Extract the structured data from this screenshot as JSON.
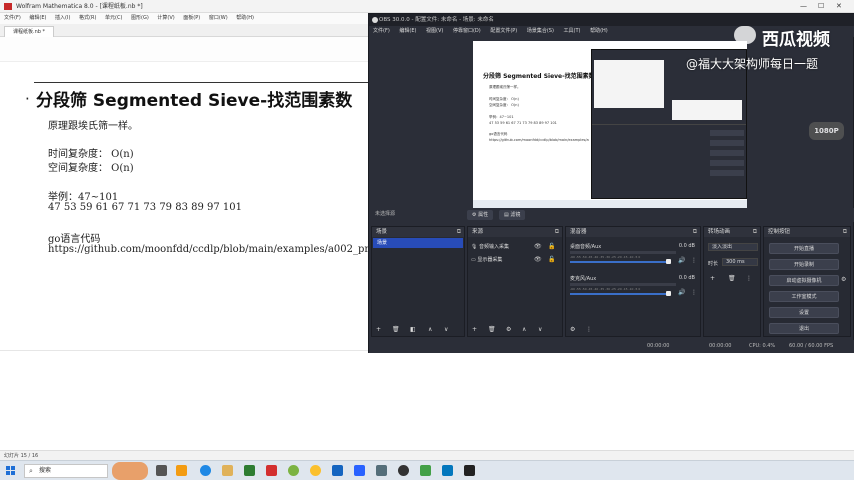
{
  "mathematica": {
    "window_title": "Wolfram Mathematica 8.0 - [课程纸板.nb *]",
    "menu": [
      "文件(F)",
      "编辑(E)",
      "插入(I)",
      "格式(R)",
      "单元(C)",
      "图形(G)",
      "计算(V)",
      "面板(P)",
      "窗口(W)",
      "帮助(H)"
    ],
    "tab_label": "课程纸板.nb *",
    "status_text": "幻灯片 15 / 16",
    "window_buttons": [
      "—",
      "☐",
      "✕"
    ]
  },
  "slide": {
    "bullet": "·",
    "title": "分段筛 Segmented Sieve-找范围素数",
    "lines": [
      "原理跟埃氏筛一样。",
      "时间复杂度： O(n)",
      "空间复杂度： O(n)",
      "举例：47~101",
      "47 53 59 61 67 71 73 79 83 89 97 101",
      "go语言代码",
      "https://github.com/moonfdd/ccdlp/blob/main/examples/a002_prime/b010_segmented_sieve"
    ]
  },
  "obs": {
    "window_title": "OBS 30.0.0 - 配置文件: 未命名 - 场景: 未命名",
    "menu": [
      "文件(F)",
      "编辑(E)",
      "视图(V)",
      "停靠窗口(D)",
      "配置文件(P)",
      "场景集合(S)",
      "工具(T)",
      "帮助(H)"
    ],
    "no_source_selected": "未选择源",
    "properties_button": "属性",
    "filters_button": "滤镜",
    "docks": {
      "scenes_title": "场景",
      "sources_title": "来源",
      "mixer_title": "混音器",
      "transitions_title": "转场动画",
      "controls_title": "控制按钮"
    },
    "scenes": [
      "场景"
    ],
    "sources": [
      {
        "name": "音频输入采集",
        "icon": "microphone-icon"
      },
      {
        "name": "显示器采集",
        "icon": "monitor-icon"
      }
    ],
    "mixer": [
      {
        "name": "桌面音频/Aux",
        "db": "0.0 dB"
      },
      {
        "name": "麦克风/Aux",
        "db": "0.0 dB"
      }
    ],
    "mixer_scale": "-60 -55 -50 -45 -40 -35 -30 -25 -20 -15 -10 -5 0",
    "transition": {
      "type": "淡入淡出",
      "duration_label": "时长",
      "duration": "300 ms"
    },
    "controls": [
      "开始直播",
      "开始录制",
      "启动虚拟摄像机",
      "工作室模式",
      "设置",
      "退出"
    ],
    "status": {
      "live": "00:00:00",
      "rec": "00:00:00",
      "cpu": "CPU: 0.4%",
      "fps": "60.00 / 60.00 FPS"
    },
    "preview_lines": [
      "原理跟埃氏筛一样。",
      "时间复杂度： O(n)",
      "空间复杂度： O(n)",
      "举例：47~101",
      "47 53 59 61 67 71 73 79 83 89 97 101",
      "go语言代码",
      "https://github.com/moonfdd/ccdlp/blob/main/examples/a002_prime/b010_segmented_sieve"
    ]
  },
  "watermark": {
    "brand": "西瓜视频",
    "author": "@福大大架构师每日一题",
    "quality_badge": "1080P"
  },
  "taskbar": {
    "search_placeholder": "搜索"
  },
  "colors": {
    "obs_bg": "#2b2e38",
    "obs_selected": "#284cb8",
    "meter_blue": "#3a6fc9"
  }
}
